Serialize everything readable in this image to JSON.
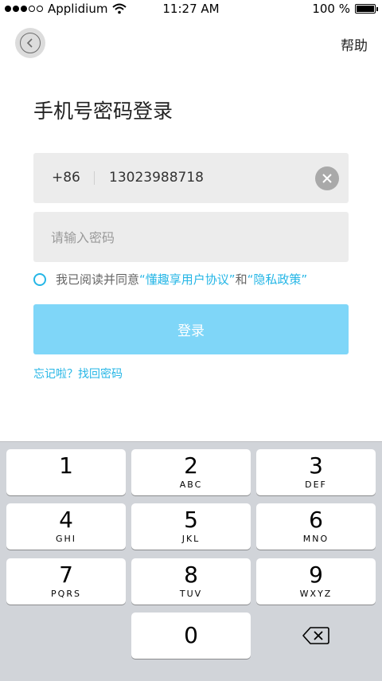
{
  "status_bar": {
    "carrier": "Applidium",
    "time": "11:27 AM",
    "battery": "100 %",
    "battery_level": 1.0
  },
  "header": {
    "back_icon": "chevron-left-icon",
    "help_label": "帮助"
  },
  "title": "手机号密码登录",
  "phone": {
    "country_code": "+86",
    "number": "13023988718",
    "clear_icon": "close-circle-icon"
  },
  "password": {
    "placeholder": "请输入密码"
  },
  "agreement": {
    "prefix": "我已阅读并同意",
    "user_agreement": "“懂趣享用户协议”",
    "and": "和",
    "privacy_policy": "“隐私政策”"
  },
  "login_button": "登录",
  "forgot_link": "忘记啦？找回密码",
  "keyboard": {
    "keys": [
      {
        "digit": "1",
        "letters": ""
      },
      {
        "digit": "2",
        "letters": "ABC"
      },
      {
        "digit": "3",
        "letters": "DEF"
      },
      {
        "digit": "4",
        "letters": "GHI"
      },
      {
        "digit": "5",
        "letters": "JKL"
      },
      {
        "digit": "6",
        "letters": "MNO"
      },
      {
        "digit": "7",
        "letters": "PQRS"
      },
      {
        "digit": "8",
        "letters": "TUV"
      },
      {
        "digit": "9",
        "letters": "WXYZ"
      }
    ],
    "zero": "0",
    "delete_icon": "backspace-icon"
  },
  "colors": {
    "accent": "#25b6e6",
    "button": "#7fd6f8",
    "input_bg": "#ececec",
    "keyboard_bg": "#d1d4d9"
  }
}
